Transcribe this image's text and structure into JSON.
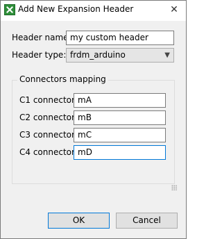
{
  "window": {
    "title": "Add New Expansion Header",
    "close_glyph": "✕"
  },
  "form": {
    "header_name_label": "Header name:",
    "header_name_value": "my custom header",
    "header_type_label": "Header type:",
    "header_type_value": "frdm_arduino"
  },
  "group": {
    "title": "Connectors mapping",
    "rows": [
      {
        "label": "C1 connector:",
        "value": "mA"
      },
      {
        "label": "C2 connector:",
        "value": "mB"
      },
      {
        "label": "C3 connector:",
        "value": "mC"
      },
      {
        "label": "C4 connector:",
        "value": "mD"
      }
    ]
  },
  "buttons": {
    "ok": "OK",
    "cancel": "Cancel"
  },
  "colors": {
    "focus_border": "#0078d7",
    "dialog_bg": "#f0f0f0"
  }
}
